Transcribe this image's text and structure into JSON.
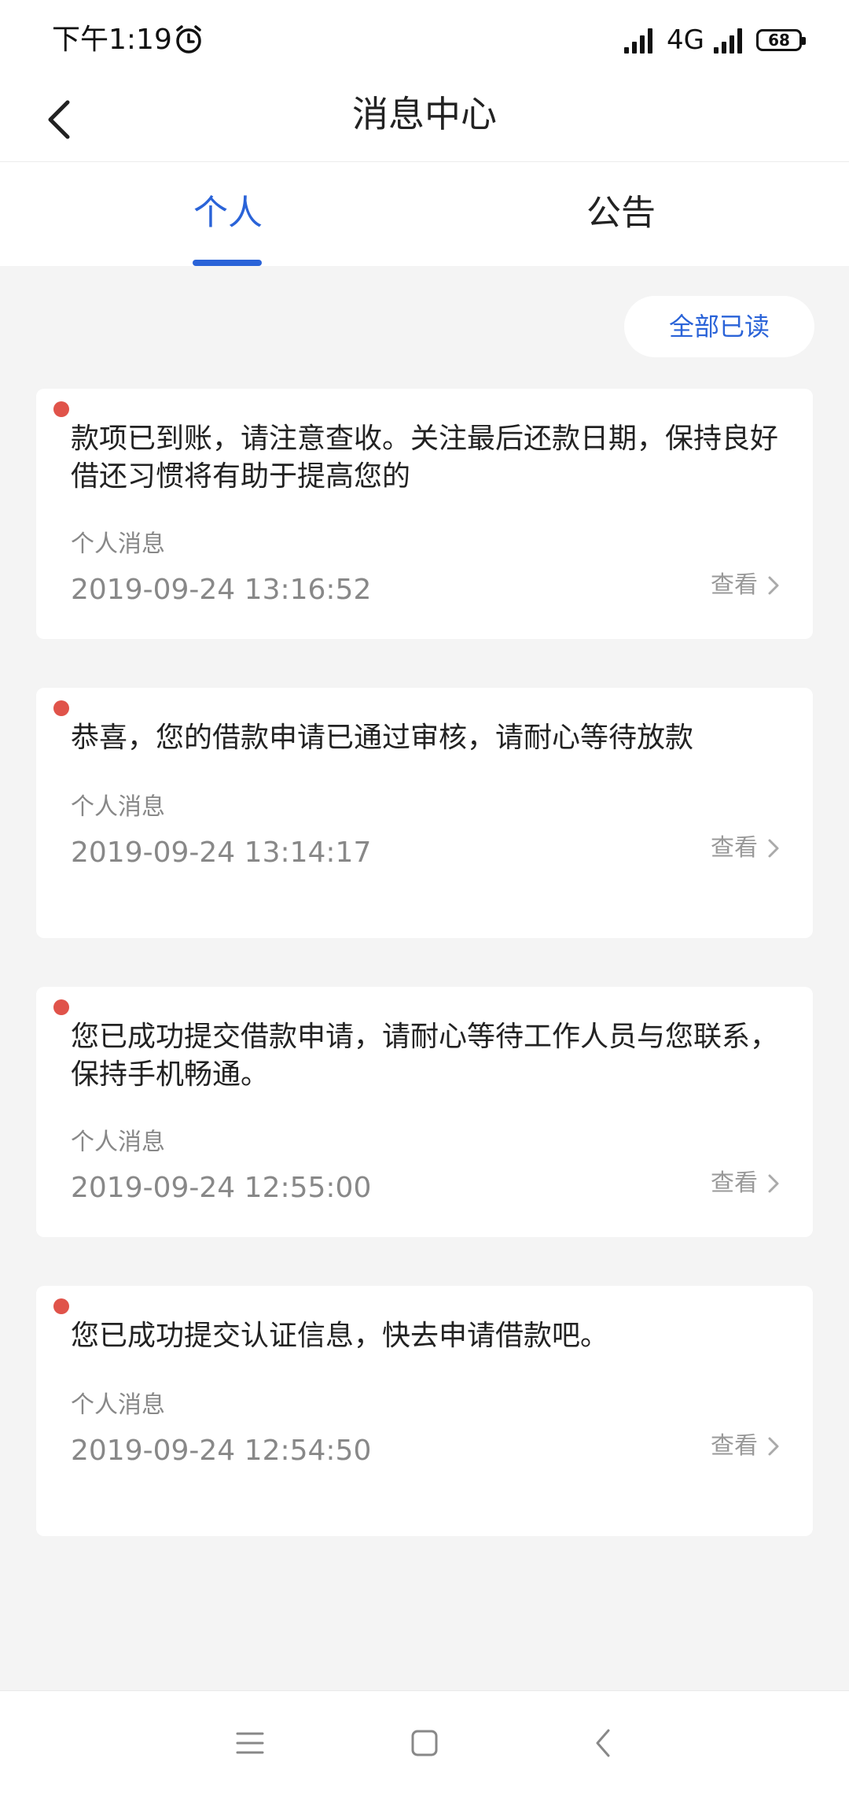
{
  "status_bar": {
    "time": "下午1:19",
    "network": "4G",
    "battery": "68"
  },
  "header": {
    "title": "消息中心"
  },
  "tabs": [
    {
      "label": "个人",
      "active": true
    },
    {
      "label": "公告",
      "active": false
    }
  ],
  "mark_all_read_label": "全部已读",
  "messages": [
    {
      "content": "款项已到账，请注意查收。关注最后还款日期，保持良好借还习惯将有助于提高您的",
      "category": "个人消息",
      "time": "2019-09-24 13:16:52",
      "action": "查看",
      "unread": true
    },
    {
      "content": "恭喜，您的借款申请已通过审核，请耐心等待放款",
      "category": "个人消息",
      "time": "2019-09-24 13:14:17",
      "action": "查看",
      "unread": true
    },
    {
      "content": "您已成功提交借款申请，请耐心等待工作人员与您联系，保持手机畅通。",
      "category": "个人消息",
      "time": "2019-09-24 12:55:00",
      "action": "查看",
      "unread": true
    },
    {
      "content": "您已成功提交认证信息，快去申请借款吧。",
      "category": "个人消息",
      "time": "2019-09-24 12:54:50",
      "action": "查看",
      "unread": true
    }
  ],
  "colors": {
    "accent": "#2a63d8",
    "unread_dot": "#e0534a",
    "background": "#f4f4f4"
  },
  "icons": {
    "back": "chevron-left-icon",
    "alarm": "alarm-clock-icon",
    "signal": "signal-icon",
    "view": "chevron-right-icon",
    "nav_menu": "menu-icon",
    "nav_home": "home-square-icon",
    "nav_back": "back-triangle-icon"
  }
}
